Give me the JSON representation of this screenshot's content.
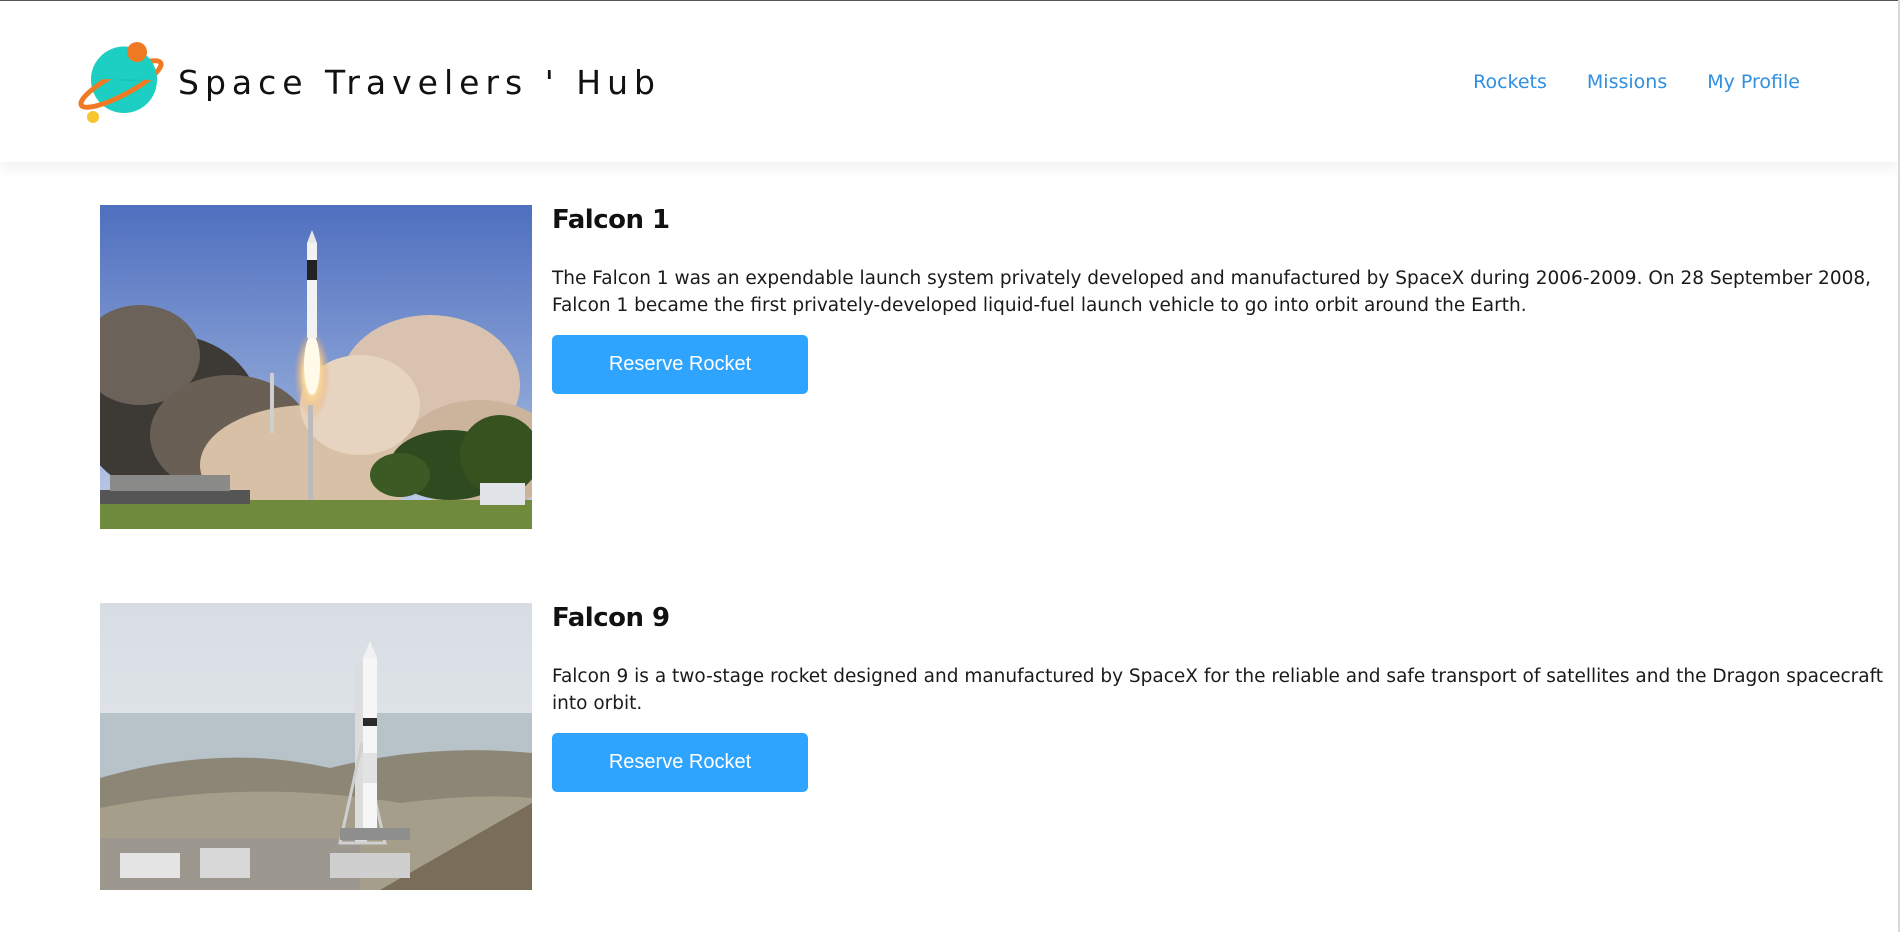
{
  "header": {
    "title": "Space Travelers ' Hub",
    "nav": [
      {
        "label": "Rockets"
      },
      {
        "label": "Missions"
      },
      {
        "label": "My Profile"
      }
    ]
  },
  "rockets": [
    {
      "name": "Falcon 1",
      "description": "The Falcon 1 was an expendable launch system privately developed and manufactured by SpaceX during 2006-2009. On 28 September 2008, Falcon 1 became the first privately-developed liquid-fuel launch vehicle to go into orbit around the Earth.",
      "button_label": "Reserve Rocket"
    },
    {
      "name": "Falcon 9",
      "description": "Falcon 9 is a two-stage rocket designed and manufactured by SpaceX for the reliable and safe transport of satellites and the Dragon spacecraft into orbit.",
      "button_label": "Reserve Rocket"
    }
  ],
  "colors": {
    "nav_link": "#2f8fe0",
    "button": "#2fa4ff",
    "logo_planet": "#1ccfc2",
    "logo_ring": "#f07a24",
    "logo_moon": "#f5c630"
  },
  "icons": {
    "logo": "planet-logo-icon"
  }
}
